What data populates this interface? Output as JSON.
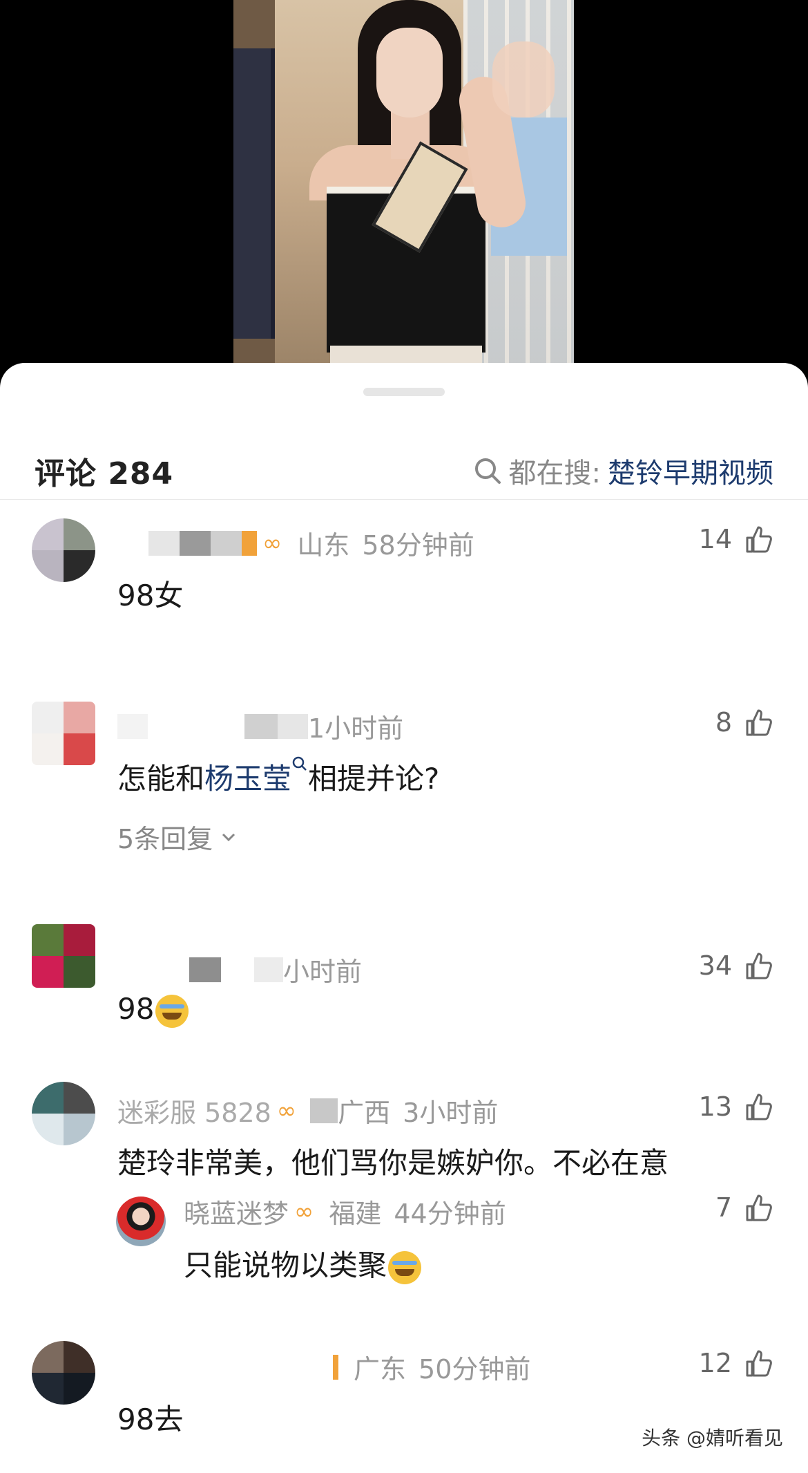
{
  "video": {
    "alt": ""
  },
  "header": {
    "title": "评论 284",
    "search_prefix": "都在搜:",
    "search_term": "楚铃早期视频"
  },
  "comments": [
    {
      "location": "山东",
      "time": "58分钟前",
      "likes": "14",
      "text": "98女"
    },
    {
      "time": "1小时前",
      "likes": "8",
      "text_before": "怎能和",
      "link": "杨玉莹",
      "text_after": "相提并论?",
      "replies": "5条回复"
    },
    {
      "time": "小时前",
      "likes": "34",
      "text": "98"
    },
    {
      "name_partial": "迷彩服 5828",
      "location": "广西",
      "time": "3小时前",
      "likes": "13",
      "text": "楚玲非常美，他们骂你是嫉妒你。不必在意",
      "reply": {
        "name": "晓蓝迷梦",
        "location": "福建",
        "time": "44分钟前",
        "likes": "7",
        "text": "只能说物以类聚"
      }
    },
    {
      "location": "广东",
      "time": "50分钟前",
      "likes": "12",
      "text": "98去"
    }
  ],
  "watermark": "头条 @婧听看见",
  "colors": {
    "link": "#1d3b6e",
    "meta": "#999999",
    "badge": "#f1a23a"
  },
  "icons": [
    "search-icon",
    "thumbs-up-icon",
    "chevron-down-icon",
    "verified-badge-icon",
    "emoji-icon"
  ]
}
